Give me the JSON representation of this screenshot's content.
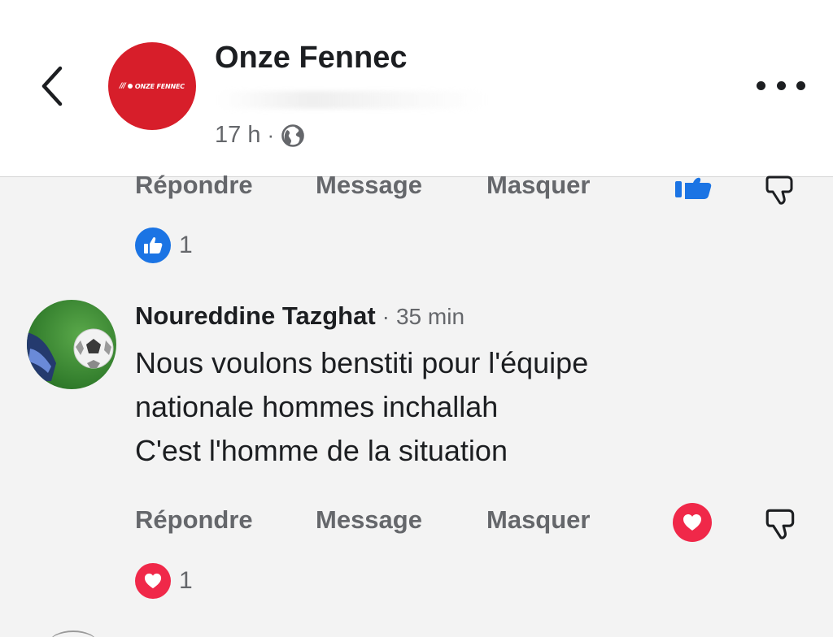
{
  "header": {
    "page_name": "Onze Fennec",
    "avatar_logo_text": "ONZE FENNEC",
    "time": "17 h",
    "separator": "·",
    "audience_icon": "globe-icon",
    "back_icon": "chevron-left-icon",
    "more_icon": "more-horizontal-icon"
  },
  "comments": [
    {
      "actions": {
        "reply": "Répondre",
        "message": "Message",
        "hide": "Masquer"
      },
      "my_reaction": "like",
      "reaction_summary": {
        "icon": "like-icon",
        "count": "1"
      }
    },
    {
      "author": "Noureddine Tazghat",
      "separator": "·",
      "time": "35 min",
      "avatar": "football-avatar",
      "text_lines": [
        "Nous voulons benstiti pour l'équipe",
        "nationale hommes inchallah",
        "C'est l'homme de la situation"
      ],
      "actions": {
        "reply": "Répondre",
        "message": "Message",
        "hide": "Masquer"
      },
      "my_reaction": "love",
      "reaction_summary": {
        "icon": "love-icon",
        "count": "1"
      }
    }
  ],
  "colors": {
    "brand_red": "#d71e2a",
    "like_blue": "#1b74e4",
    "love_red": "#f02849",
    "secondary_text": "#65676b",
    "primary_text": "#1c1e21"
  }
}
